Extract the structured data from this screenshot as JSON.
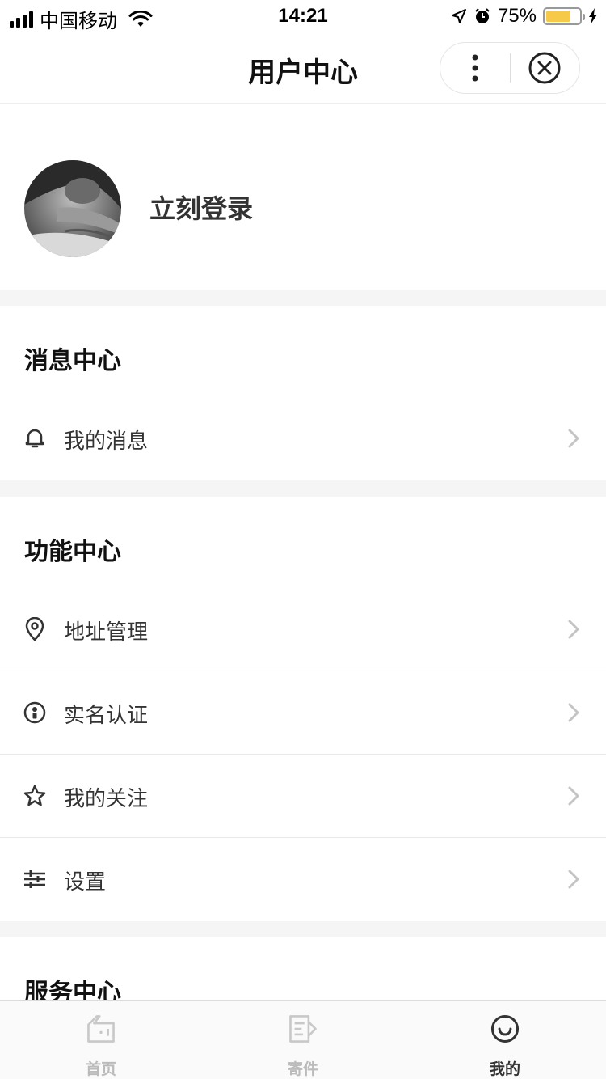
{
  "status_bar": {
    "carrier": "中国移动",
    "time": "14:21",
    "battery_percent": "75%",
    "battery_level": 0.75
  },
  "nav": {
    "title": "用户中心"
  },
  "profile": {
    "login_label": "立刻登录"
  },
  "sections": {
    "messages": {
      "title": "消息中心",
      "items": [
        {
          "label": "我的消息",
          "icon": "bell-icon"
        }
      ]
    },
    "functions": {
      "title": "功能中心",
      "items": [
        {
          "label": "地址管理",
          "icon": "location-pin-icon"
        },
        {
          "label": "实名认证",
          "icon": "id-badge-icon"
        },
        {
          "label": "我的关注",
          "icon": "star-icon"
        },
        {
          "label": "设置",
          "icon": "sliders-icon"
        }
      ]
    },
    "services": {
      "title": "服务中心"
    }
  },
  "tabbar": {
    "tabs": [
      {
        "label": "首页",
        "icon": "home-icon",
        "active": false
      },
      {
        "label": "寄件",
        "icon": "send-package-icon",
        "active": false
      },
      {
        "label": "我的",
        "icon": "smiley-icon",
        "active": true
      }
    ]
  },
  "colors": {
    "battery": "#f7c948",
    "section_gap": "#f5f5f5",
    "tab_inactive": "#bbbbbb",
    "tab_active": "#333333"
  }
}
